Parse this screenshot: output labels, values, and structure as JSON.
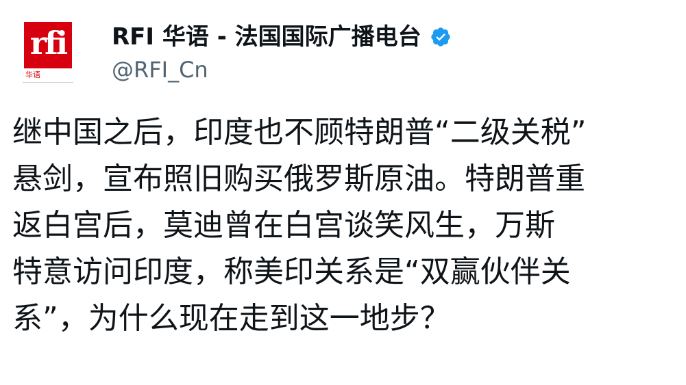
{
  "account": {
    "display_name": "RFI 华语 - 法国国际广播电台",
    "handle": "@RFI_Cn",
    "verified_icon": "verified-badge-icon",
    "avatar": {
      "logo_text": "rfi",
      "logo_sub": "华语",
      "brand_color": "#d7000f"
    }
  },
  "tweet": {
    "lines": [
      "继中国之后，印度也不顾特朗普“二级关税”",
      "悬剑，宣布照旧购买俄罗斯原油。特朗普重",
      "返白宫后，莫迪曾在白宫谈笑风生，万斯",
      "特意访问印度，称美印关系是“双赢伙伴关",
      "系”，为什么现在走到这一地步？"
    ]
  },
  "colors": {
    "text": "#0f1419",
    "secondary": "#536471",
    "verified": "#1d9bf0"
  }
}
